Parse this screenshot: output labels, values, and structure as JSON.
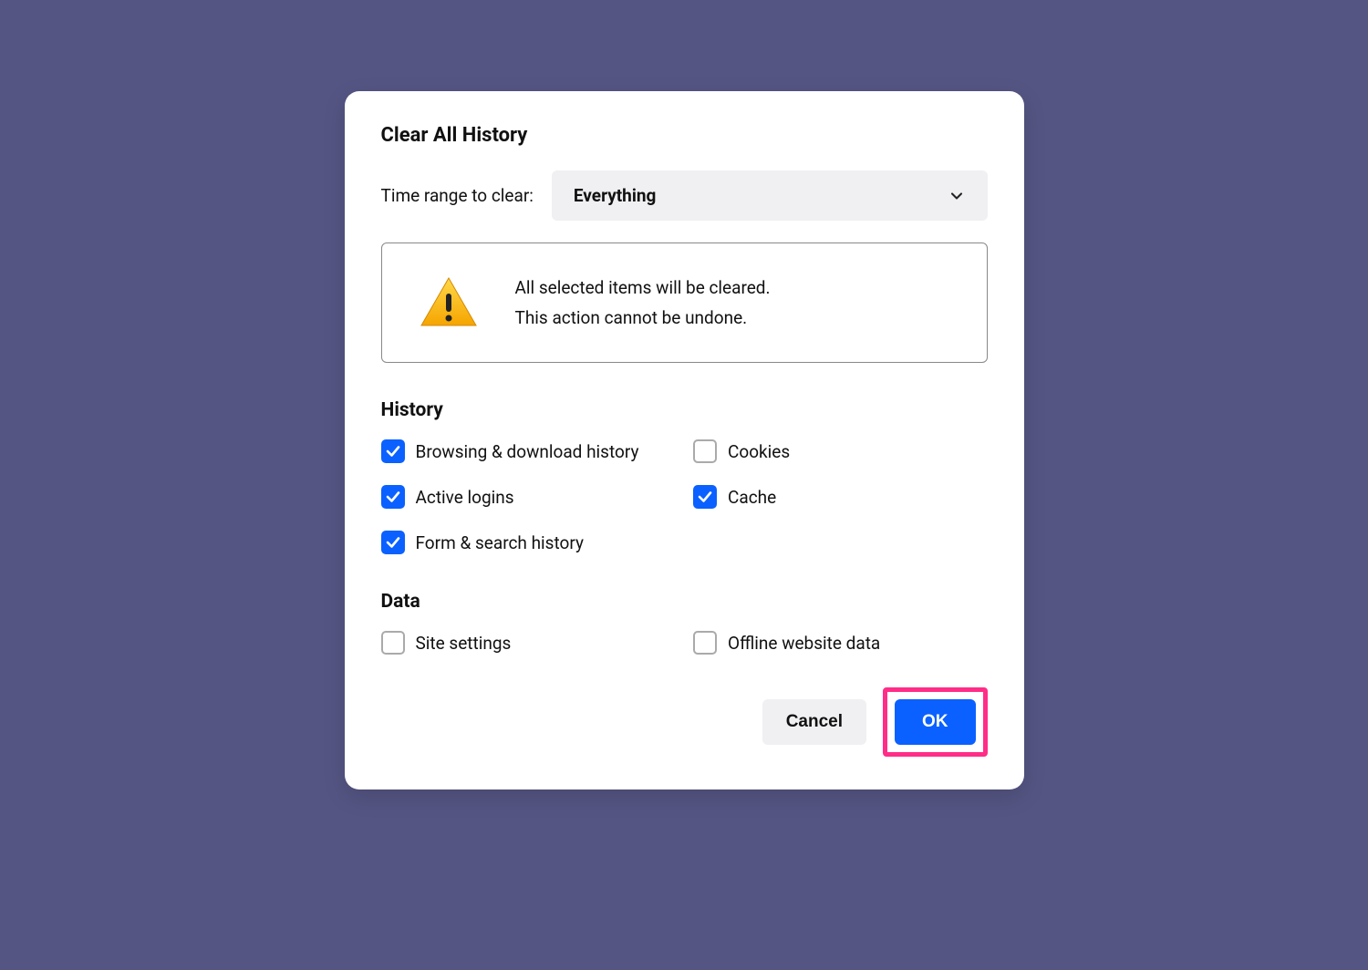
{
  "dialog": {
    "title": "Clear All History",
    "timeRange": {
      "label": "Time range to clear:",
      "value": "Everything"
    },
    "warning": {
      "line1": "All selected items will be cleared.",
      "line2": "This action cannot be undone."
    },
    "sections": {
      "history": {
        "header": "History",
        "items": [
          {
            "label": "Browsing & download history",
            "checked": true
          },
          {
            "label": "Cookies",
            "checked": false
          },
          {
            "label": "Active logins",
            "checked": true
          },
          {
            "label": "Cache",
            "checked": true
          },
          {
            "label": "Form & search history",
            "checked": true
          }
        ]
      },
      "data": {
        "header": "Data",
        "items": [
          {
            "label": "Site settings",
            "checked": false
          },
          {
            "label": "Offline website data",
            "checked": false
          }
        ]
      }
    },
    "buttons": {
      "cancel": "Cancel",
      "ok": "OK"
    }
  }
}
